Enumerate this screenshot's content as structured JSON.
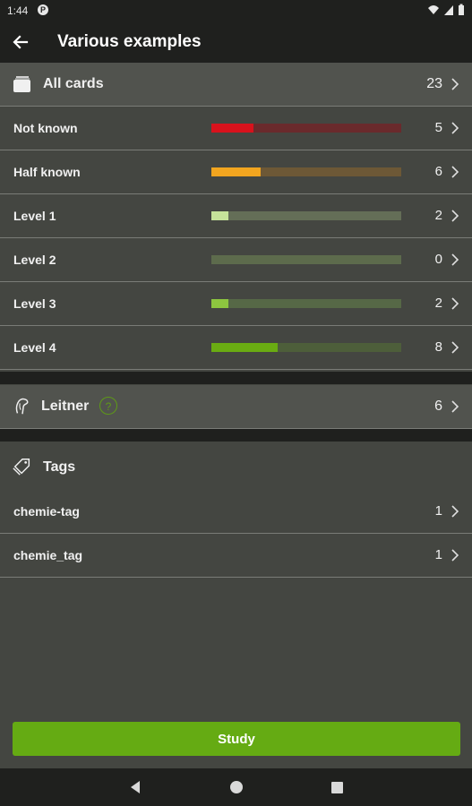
{
  "status_bar": {
    "time": "1:44",
    "p_icon_label": "P"
  },
  "app_bar": {
    "title": "Various examples"
  },
  "all_cards": {
    "label": "All cards",
    "count": "23"
  },
  "levels": [
    {
      "label": "Not known",
      "count": "5",
      "fill": 0.22,
      "fill_color": "#d8121c",
      "track_color": "#6a2a2c"
    },
    {
      "label": "Half known",
      "count": "6",
      "fill": 0.26,
      "fill_color": "#f2a51f",
      "track_color": "#6d5836"
    },
    {
      "label": "Level 1",
      "count": "2",
      "fill": 0.09,
      "fill_color": "#c6e39a",
      "track_color": "#646e57"
    },
    {
      "label": "Level 2",
      "count": "0",
      "fill": 0.0,
      "fill_color": "#a9cf63",
      "track_color": "#5d6b4c"
    },
    {
      "label": "Level 3",
      "count": "2",
      "fill": 0.09,
      "fill_color": "#8dc63f",
      "track_color": "#566846"
    },
    {
      "label": "Level 4",
      "count": "8",
      "fill": 0.35,
      "fill_color": "#6aac12",
      "track_color": "#4d5e3a"
    }
  ],
  "leitner": {
    "label": "Leitner",
    "count": "6",
    "help_icon": "?"
  },
  "tags": {
    "label": "Tags",
    "items": [
      {
        "label": "chemie-tag",
        "count": "1"
      },
      {
        "label": "chemie_tag",
        "count": "1"
      }
    ]
  },
  "study_button": {
    "label": "Study"
  },
  "colors": {
    "accent": "#65ab13",
    "bar_bg": "#1f201e",
    "page_bg": "#444641"
  }
}
